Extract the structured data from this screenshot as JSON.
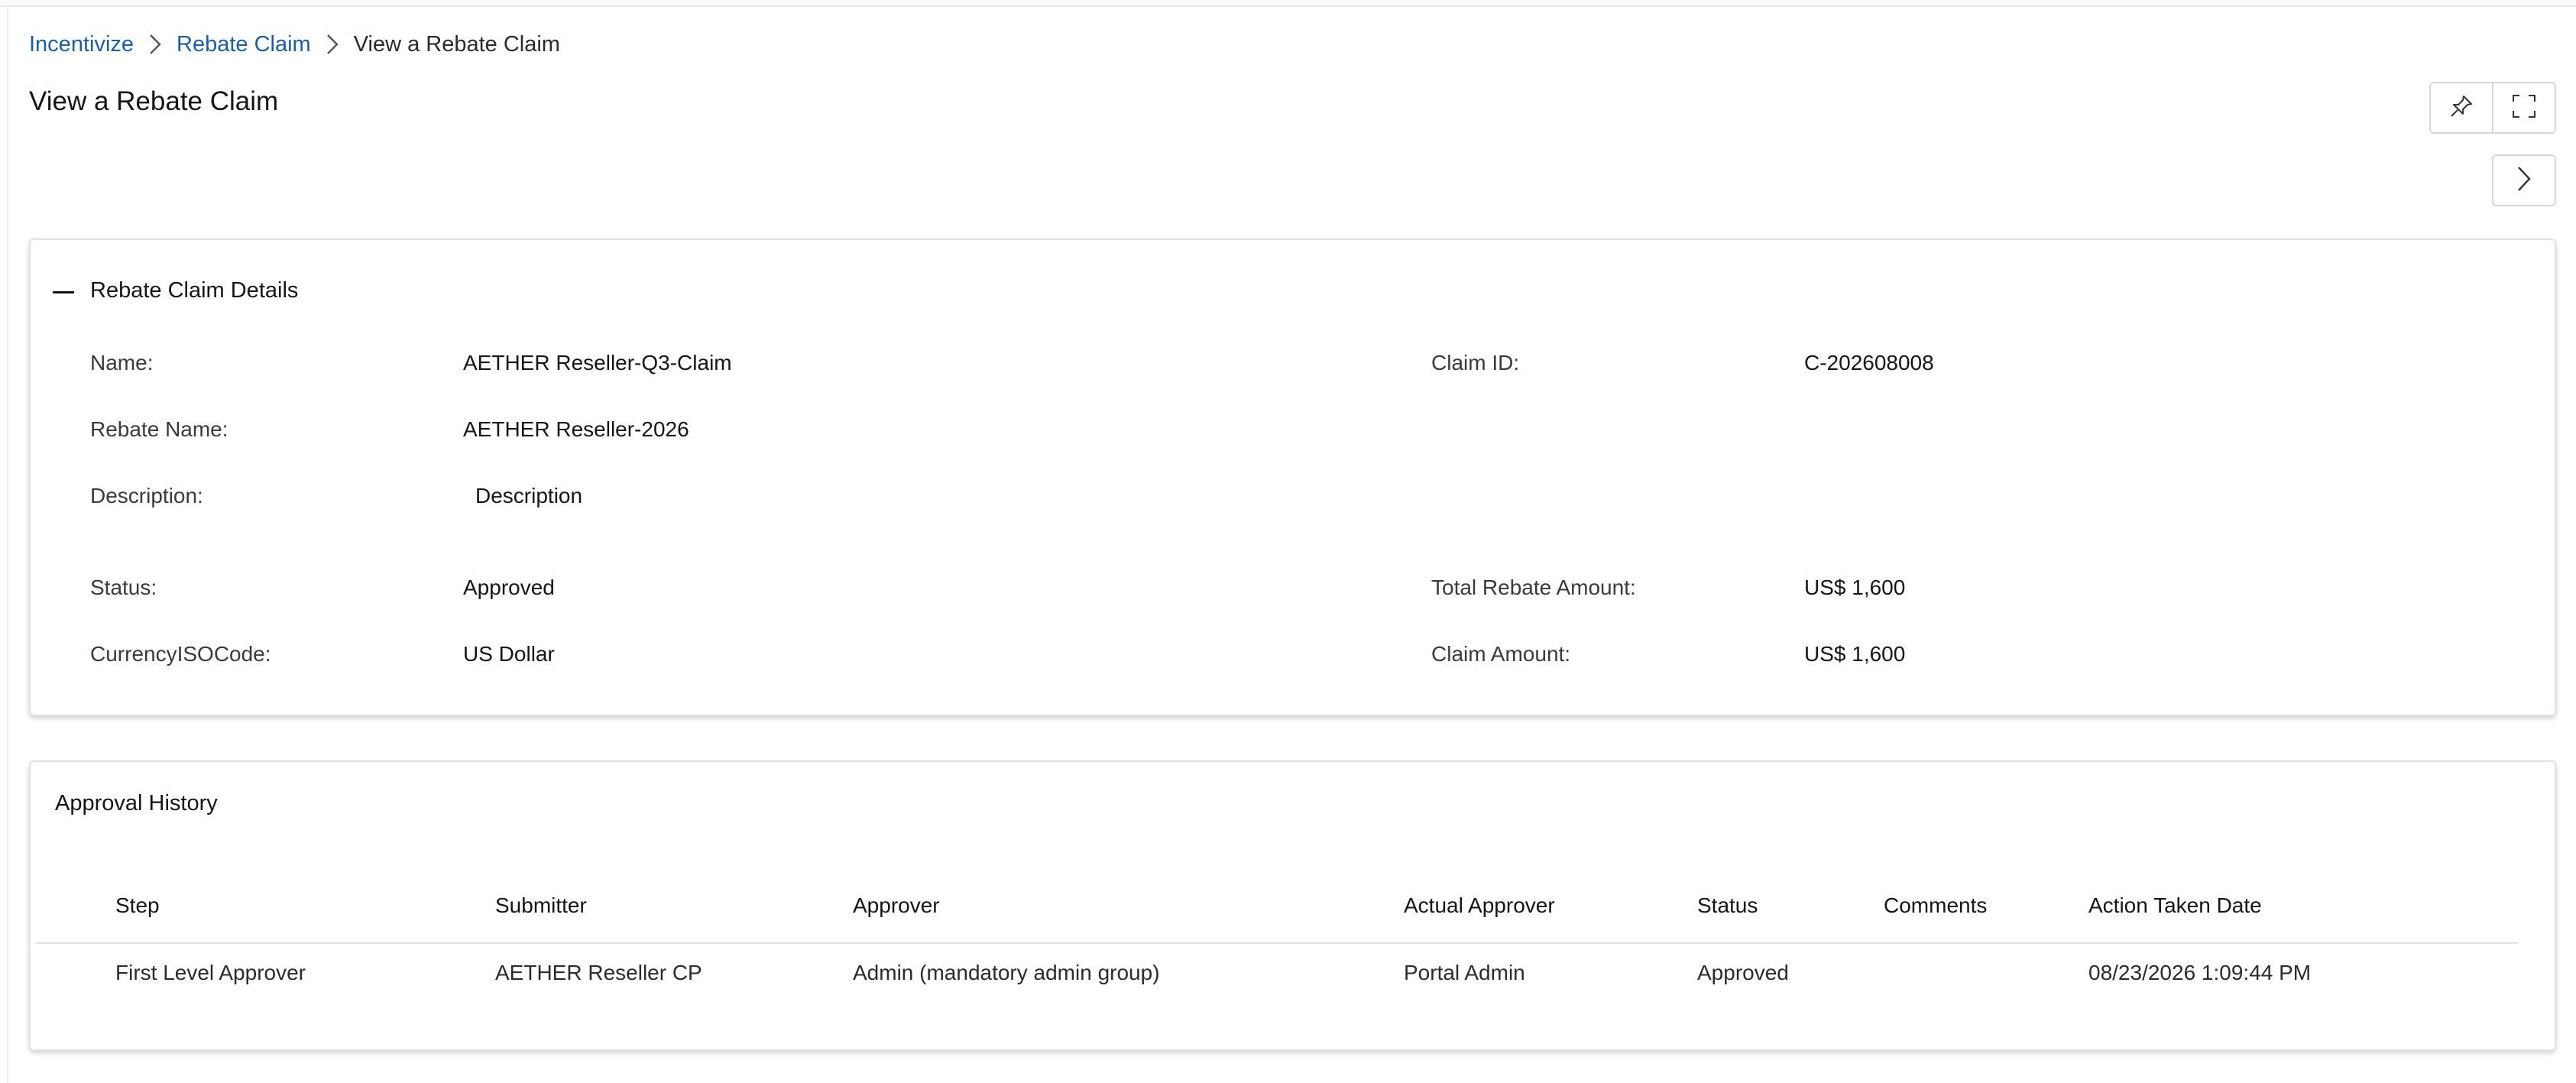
{
  "breadcrumb": {
    "items": [
      {
        "label": "Incentivize"
      },
      {
        "label": "Rebate Claim"
      },
      {
        "label": "View a Rebate Claim"
      }
    ]
  },
  "page": {
    "title": "View a Rebate Claim"
  },
  "toolbar": {
    "pin_icon": "pin-icon",
    "expand_icon": "fullscreen-icon",
    "next_icon": "chevron-right-icon"
  },
  "details": {
    "title": "Rebate Claim Details",
    "toggle_icon": "minus-icon",
    "name_label": "Name:",
    "name_value": "AETHER Reseller-Q3-Claim",
    "claim_id_label": "Claim ID:",
    "claim_id_value": "C-202608008",
    "rebate_name_label": "Rebate Name:",
    "rebate_name_value": "AETHER Reseller-2026",
    "description_label": "Description:",
    "description_value": "Description",
    "status_label": "Status:",
    "status_value": "Approved",
    "total_label": "Total Rebate Amount:",
    "total_value": "US$ 1,600",
    "currency_label": "CurrencyISOCode:",
    "currency_value": "US Dollar",
    "claim_amount_label": "Claim Amount:",
    "claim_amount_value": "US$ 1,600"
  },
  "history": {
    "title": "Approval History",
    "columns": [
      "Step",
      "Submitter",
      "Approver",
      "Actual Approver",
      "Status",
      "Comments",
      "Action Taken Date"
    ],
    "rows": [
      [
        "First Level Approver",
        "AETHER Reseller CP",
        "Admin (mandatory admin group)",
        "Portal Admin",
        "Approved",
        "",
        "08/23/2026 1:09:44 PM"
      ]
    ]
  }
}
